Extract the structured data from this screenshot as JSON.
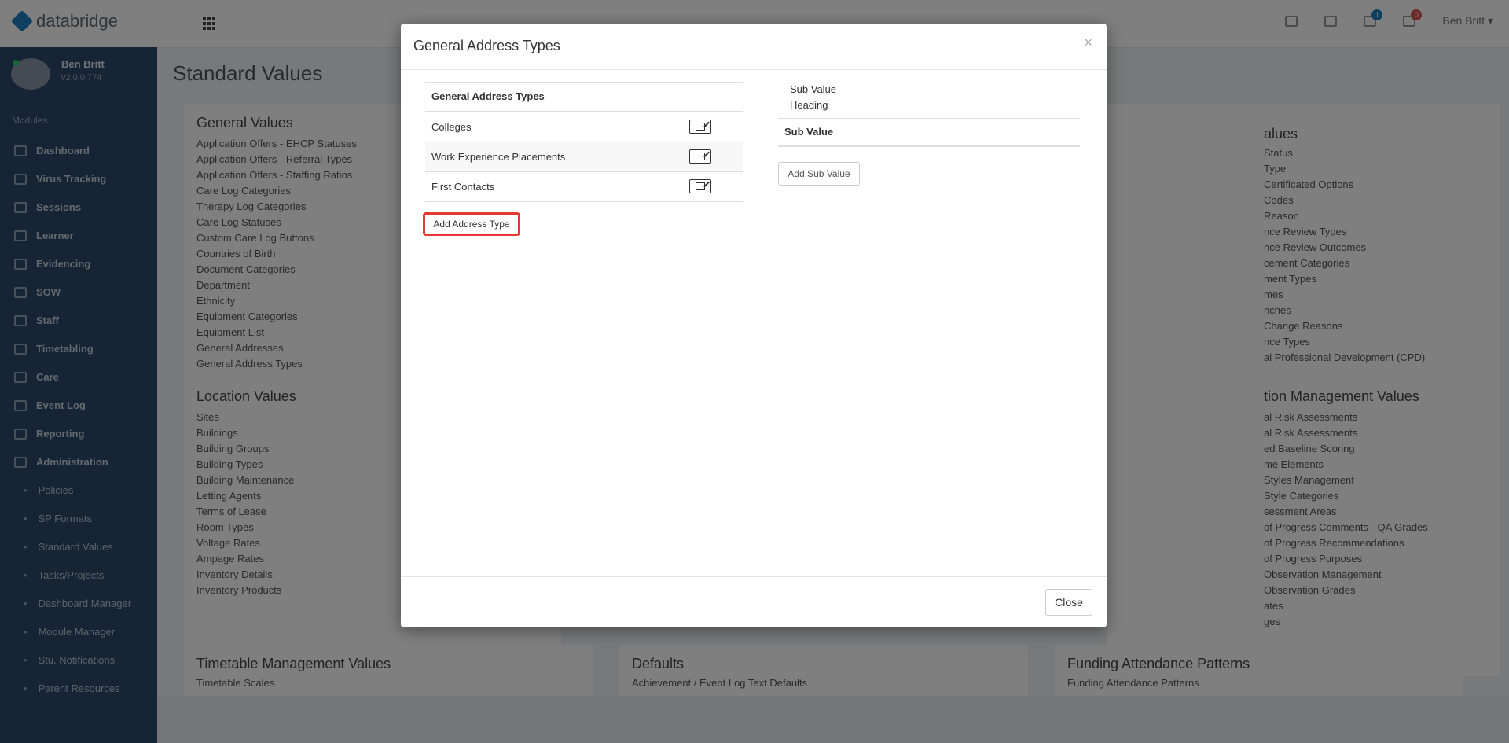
{
  "app": {
    "brand": "databridge",
    "user_menu": "Ben Britt",
    "notif_badge_1": "1",
    "notif_badge_2": "0"
  },
  "sidebar": {
    "user_name": "Ben Britt",
    "version": "v2.0.0.774",
    "modules_heading": "Modules",
    "items": [
      "Dashboard",
      "Virus Tracking",
      "Sessions",
      "Learner",
      "Evidencing",
      "SOW",
      "Staff",
      "Timetabling",
      "Care",
      "Event Log",
      "Reporting",
      "Administration"
    ],
    "sub_items": [
      "Policies",
      "SP Formats",
      "Standard Values",
      "Tasks/Projects",
      "Dashboard Manager",
      "Module Manager",
      "Stu. Notifications",
      "Parent Resources"
    ]
  },
  "page": {
    "title": "Standard Values",
    "general_values": {
      "title": "General Values",
      "items": [
        "Application Offers - EHCP Statuses",
        "Application Offers - Referral Types",
        "Application Offers - Staffing Ratios",
        "Care Log Categories",
        "Therapy Log Categories",
        "Care Log Statuses",
        "Custom Care Log Buttons",
        "Countries of Birth",
        "Document Categories",
        "Department",
        "Ethnicity",
        "Equipment Categories",
        "Equipment List",
        "General Addresses",
        "General Address Types"
      ]
    },
    "location_values": {
      "title": "Location Values",
      "items": [
        "Sites",
        "Buildings",
        "Building Groups",
        "Building Types",
        "Building Maintenance",
        "Letting Agents",
        "Terms of Lease",
        "Room Types",
        "Voltage Rates",
        "Ampage Rates",
        "Inventory Details",
        "Inventory Products"
      ]
    },
    "right_values": {
      "title": "alues",
      "items": [
        "Status",
        "Type",
        "Certificated Options",
        "Codes",
        "Reason",
        "nce Review Types",
        "nce Review Outcomes",
        "cement Categories",
        "ment Types",
        "mes",
        "nches",
        "Change Reasons",
        "nce Types",
        "al Professional Development (CPD)"
      ]
    },
    "right_mgmt": {
      "title": "tion Management Values",
      "items": [
        "al Risk Assessments",
        "al Risk Assessments",
        "ed Baseline Scoring",
        "me Elements",
        "Styles Management",
        "Style Categories",
        "sessment Areas",
        "of Progress Comments - QA Grades",
        "of Progress Recommendations",
        "of Progress Purposes",
        "Observation Management",
        "Observation Grades",
        "ates",
        "ges"
      ]
    },
    "timetable": {
      "title": "Timetable Management Values",
      "first": "Timetable Scales"
    },
    "defaults": {
      "title": "Defaults",
      "first": "Achievement / Event Log Text Defaults"
    },
    "funding": {
      "title": "Funding Attendance Patterns",
      "first": "Funding Attendance Patterns"
    }
  },
  "modal": {
    "title": "General Address Types",
    "close_x": "×",
    "table_header": "General Address Types",
    "rows": [
      "Colleges",
      "Work Experience Placements",
      "First Contacts"
    ],
    "add_type_label": "Add Address Type",
    "sub_heading_line1": "Sub Value",
    "sub_heading_line2": "Heading",
    "sub_table_header": "Sub Value",
    "add_sub_label": "Add Sub Value",
    "close_label": "Close"
  },
  "colors": {
    "sidebar": "#2d4a6a",
    "highlight": "#e53935",
    "accent": "#1e7fc2"
  }
}
